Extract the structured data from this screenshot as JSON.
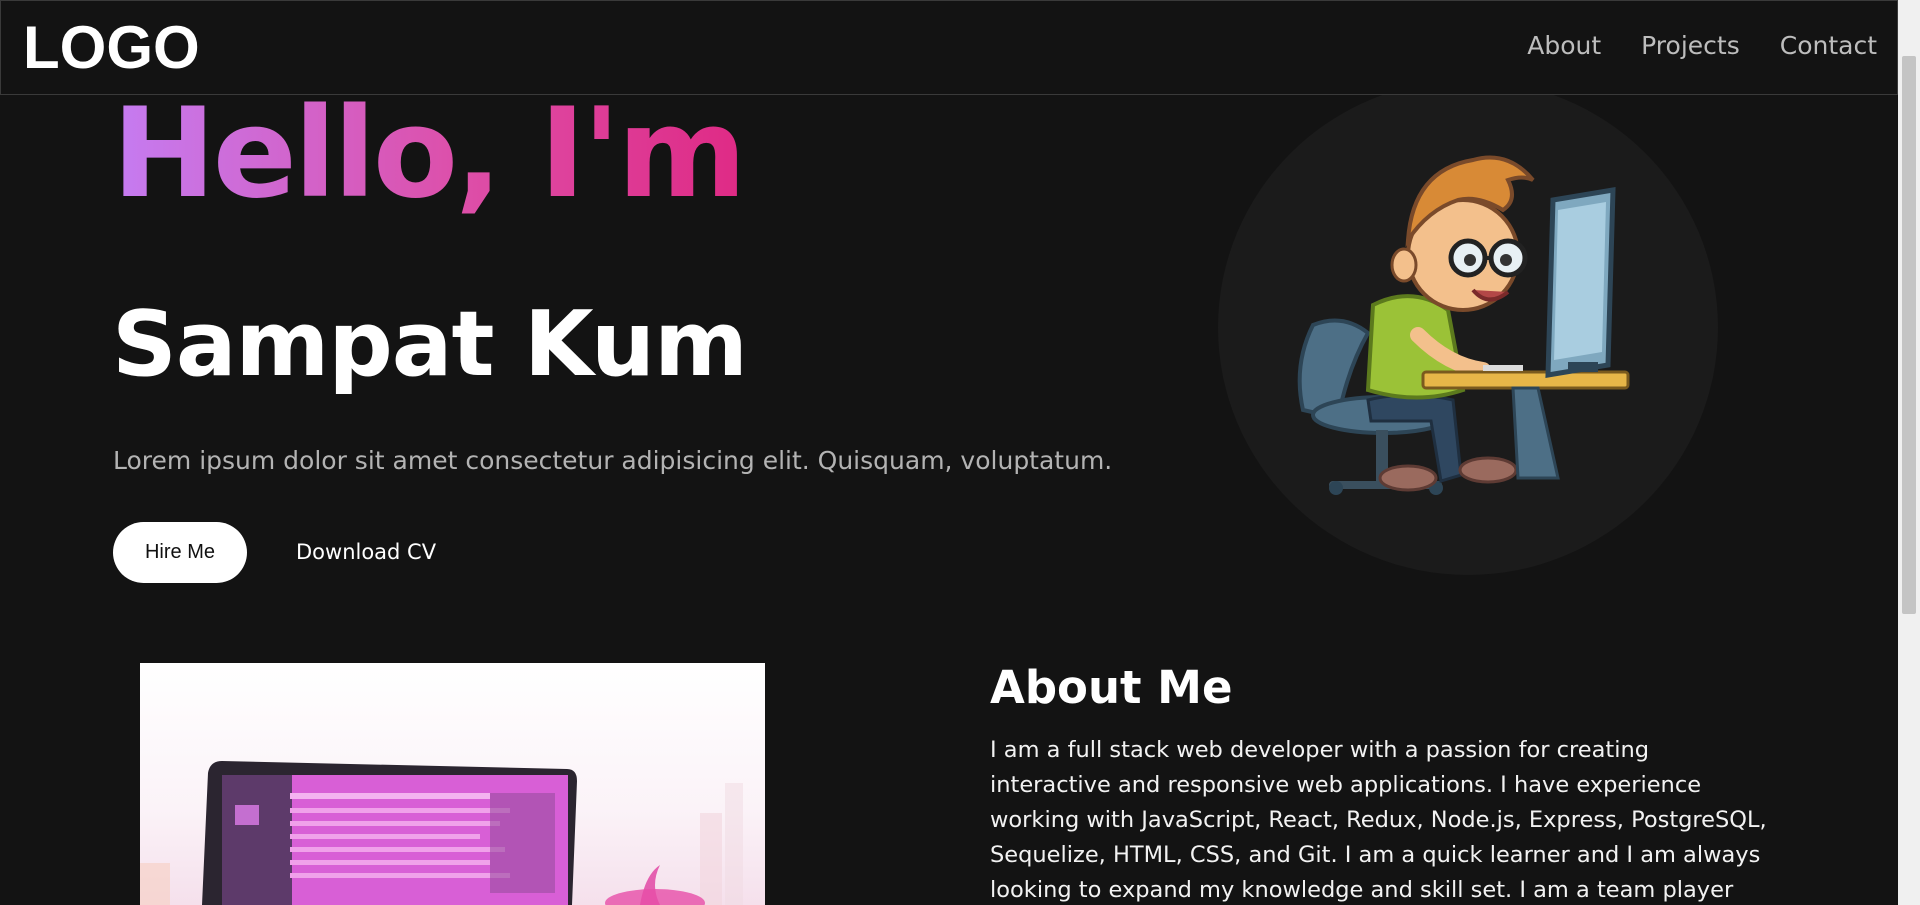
{
  "header": {
    "logo": "LOGO",
    "nav": [
      {
        "label": "About"
      },
      {
        "label": "Projects"
      },
      {
        "label": "Contact"
      }
    ]
  },
  "hero": {
    "greeting": "Hello, I'm",
    "name": "Sampat Kum",
    "tagline": "Lorem ipsum dolor sit amet consectetur adipisicing elit. Quisquam, voluptatum.",
    "hire_label": "Hire Me",
    "cv_label": "Download CV",
    "avatar_icon": "developer-illustration"
  },
  "about": {
    "title": "About Me",
    "text": "I am a full stack web developer with a passion for creating interactive and responsive web applications. I have experience working with JavaScript, React, Redux, Node.js, Express, PostgreSQL, Sequelize, HTML, CSS, and Git. I am a quick learner and I am always looking to expand my knowledge and skill set. I am a team player and I am excited",
    "image_icon": "laptop-illustration"
  },
  "colors": {
    "background": "#131313",
    "gradient_start": "#c57cf2",
    "gradient_end": "#df2a85",
    "nav_text": "#bdbdbd"
  }
}
